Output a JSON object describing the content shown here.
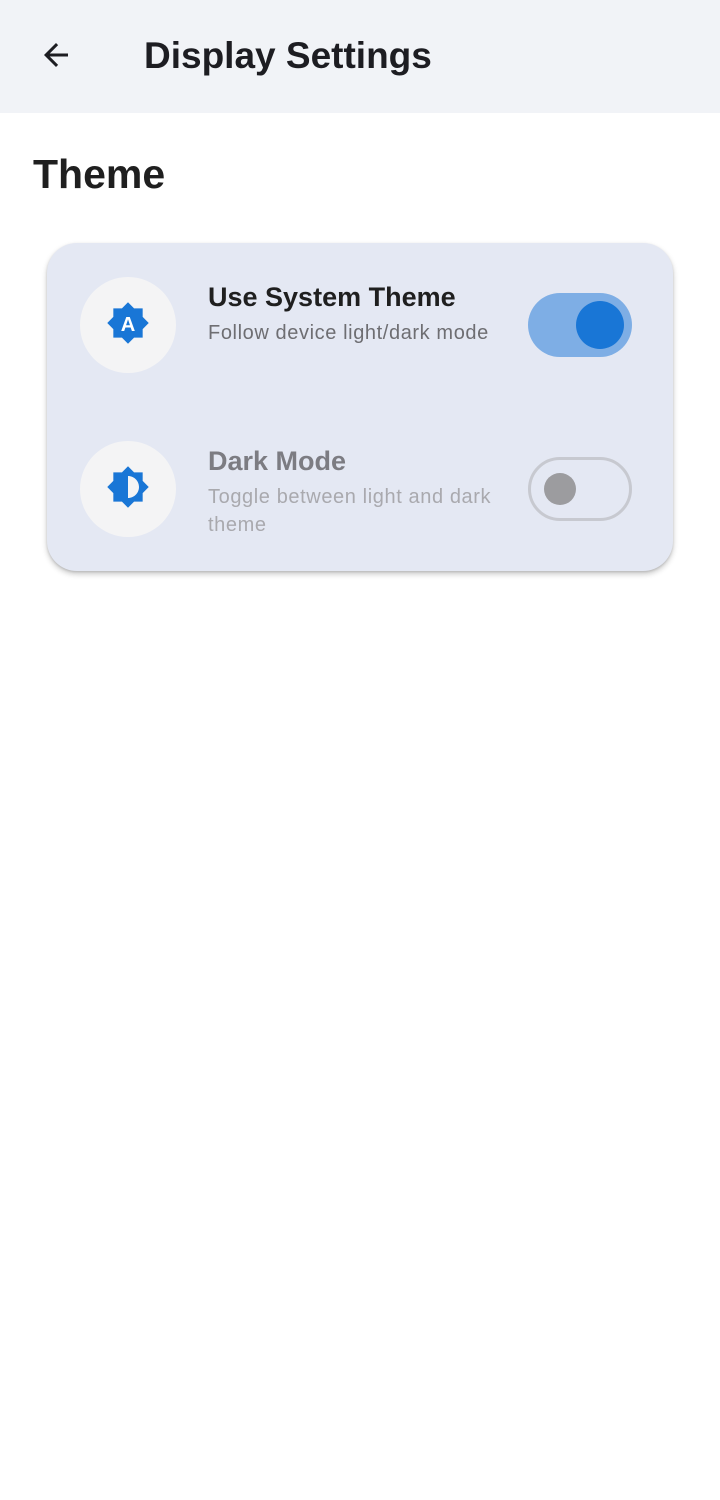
{
  "appbar": {
    "title": "Display Settings",
    "back_icon": "arrow-back-icon"
  },
  "section": {
    "title": "Theme"
  },
  "settings": [
    {
      "icon": "brightness-auto-icon",
      "icon_glyph": "A",
      "title": "Use System Theme",
      "subtitle": "Follow device light/dark mode",
      "enabled": true,
      "toggled": true
    },
    {
      "icon": "brightness-medium-icon",
      "title": "Dark Mode",
      "subtitle": "Toggle between light and dark theme",
      "enabled": false,
      "toggled": false
    }
  ],
  "colors": {
    "accent": "#1976d6",
    "accent_track": "#7eaee5",
    "card_bg": "#e4e8f3",
    "appbar_bg": "#f1f3f7"
  }
}
